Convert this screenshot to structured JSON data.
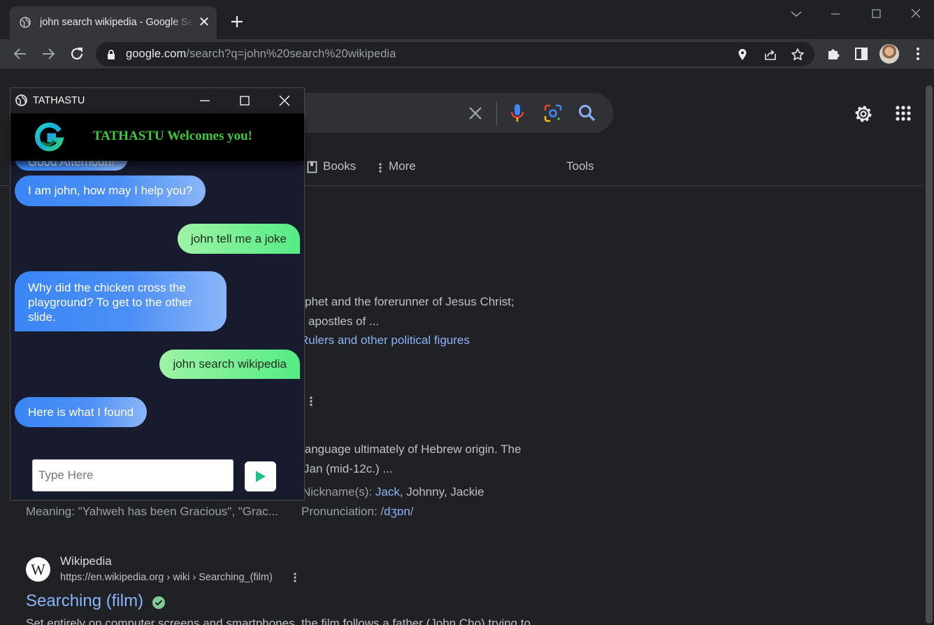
{
  "browser": {
    "tab_title": "john search wikipedia - Google Search",
    "url_domain": "google.com",
    "url_path": "/search?q=john%20search%20wikipedia"
  },
  "google": {
    "nav_tabs": [
      "Books",
      "More",
      "Tools"
    ],
    "snippet_1_line_1": "phet and the forerunner of Jesus Christ;",
    "snippet_1_line_2": "apostles of ...",
    "snippet_1_link": "Rulers and other political figures",
    "snippet_2_line_1": "language ultimately of Hebrew origin. The",
    "snippet_2_line_2": "Jan (mid-12c.) ...",
    "nickname_label": "Nickname(s):",
    "nickname_jack": "Jack",
    "nickname_rest": ", Johnny, Jackie",
    "meaning": "Meaning: \"Yahweh has been Gracious\", \"Grac...",
    "pronunciation_label": "Pronunciation: /",
    "pronunciation_value": "dʒɒn",
    "pronunciation_end": "/",
    "result_site": "Wikipedia",
    "result_favicon_letter": "W",
    "result_url": "https://en.wikipedia.org › wiki › Searching_(film)",
    "result_title": "Searching (film)",
    "result_snippet": "Set entirely on computer screens and smartphones, the film follows a father (John Cho) trying to"
  },
  "tathastu": {
    "window_title": "TATHASTU",
    "welcome": "TATHASTU Welcomes you!",
    "messages": [
      {
        "from": "bot",
        "text": "Good Afternoon!"
      },
      {
        "from": "bot",
        "text": "I am john, how may I help you?"
      },
      {
        "from": "user",
        "text": "john tell me a joke"
      },
      {
        "from": "bot",
        "text": "Why did the chicken cross the playground? To get to the other slide."
      },
      {
        "from": "user",
        "text": "john search wikipedia"
      },
      {
        "from": "bot",
        "text": "Here is what I found"
      }
    ],
    "input_placeholder": "Type Here"
  },
  "colors": {
    "bot_bubble": "#3a86f6",
    "user_bubble": "#54ec84",
    "welcome_text": "#3ec93b",
    "link": "#8ab4f8"
  },
  "icons": [
    "globe-icon",
    "close-icon",
    "plus-icon",
    "back-icon",
    "forward-icon",
    "reload-icon",
    "lock-icon",
    "location-icon",
    "share-icon",
    "star-icon",
    "extensions-icon",
    "sidepanel-icon",
    "menu-icon",
    "mic-icon",
    "lens-icon",
    "search-icon",
    "gear-icon",
    "apps-icon",
    "book-icon",
    "send-icon"
  ]
}
